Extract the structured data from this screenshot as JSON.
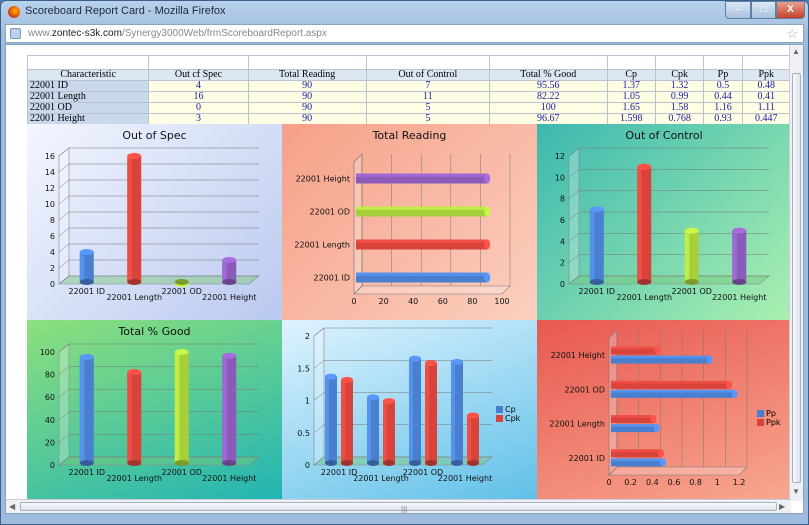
{
  "window": {
    "title": "Scoreboard Report Card - Mozilla Firefox",
    "url_prefix": "www.",
    "url_domain": "zontec-s3k.com",
    "url_path": "/Synergy3000Web/frmScoreboardReport.aspx",
    "min": "–",
    "max": "□",
    "close": "X"
  },
  "table": {
    "headers": [
      "Characteristic",
      "Out cf Spec",
      "Total Reading",
      "Out of Control",
      "Total % Good",
      "Cp",
      "Cpk",
      "Pp",
      "Ppk"
    ],
    "rows": [
      [
        "22001 ID",
        "4",
        "90",
        "7",
        "95.56",
        "1.37",
        "1.32",
        "0.5",
        "0.48"
      ],
      [
        "22001 Length",
        "16",
        "90",
        "11",
        "82.22",
        "1.05",
        "0.99",
        "0.44",
        "0.41"
      ],
      [
        "22001 OD",
        "0",
        "90",
        "5",
        "100",
        "1.65",
        "1.58",
        "1.16",
        "1.11"
      ],
      [
        "22001 Height",
        "3",
        "90",
        "5",
        "96.67",
        "1.598",
        "0.768",
        "0.93",
        "0.447"
      ]
    ]
  },
  "colors": {
    "blue": "#4a7fd0",
    "red": "#d8443c",
    "green": "#a6cf3c",
    "purple": "#8a5bb8"
  },
  "chart_data": [
    {
      "type": "bar",
      "title": "Out of Spec",
      "categories": [
        "22001 ID",
        "22001 Length",
        "22001 OD",
        "22001 Height"
      ],
      "values": [
        4,
        16,
        0,
        3
      ],
      "ylim": [
        0,
        16
      ],
      "yticks": [
        "0",
        "2",
        "4",
        "6",
        "8",
        "10",
        "12",
        "14",
        "16"
      ]
    },
    {
      "type": "bar",
      "orientation": "horizontal",
      "title": "Total Reading",
      "categories": [
        "22001 ID",
        "22001 Length",
        "22001 OD",
        "22001 Height"
      ],
      "values": [
        90,
        90,
        90,
        90
      ],
      "xlim": [
        0,
        100
      ],
      "xticks": [
        "0",
        "20",
        "40",
        "60",
        "80",
        "100"
      ]
    },
    {
      "type": "bar",
      "title": "Out of Control",
      "categories": [
        "22001 ID",
        "22001 Length",
        "22001 OD",
        "22001 Height"
      ],
      "values": [
        7,
        11,
        5,
        5
      ],
      "ylim": [
        0,
        12
      ],
      "yticks": [
        "0",
        "2",
        "4",
        "6",
        "8",
        "10",
        "12"
      ]
    },
    {
      "type": "bar",
      "title": "Total % Good",
      "categories": [
        "22001 ID",
        "22001 Length",
        "22001 OD",
        "22001 Height"
      ],
      "values": [
        95.56,
        82.22,
        100,
        96.67
      ],
      "ylim": [
        0,
        100
      ],
      "yticks": [
        "0",
        "20",
        "40",
        "60",
        "80",
        "100"
      ]
    },
    {
      "type": "bar",
      "title": "",
      "categories": [
        "22001 ID",
        "22001 Length",
        "22001 OD",
        "22001 Height"
      ],
      "series": [
        {
          "name": "Cp",
          "values": [
            1.37,
            1.05,
            1.65,
            1.598
          ]
        },
        {
          "name": "Cpk",
          "values": [
            1.32,
            0.99,
            1.58,
            0.768
          ]
        }
      ],
      "ylim": [
        0,
        2
      ],
      "yticks": [
        "0",
        "0.5",
        "1",
        "1.5",
        "2"
      ],
      "legend": "right"
    },
    {
      "type": "bar",
      "orientation": "horizontal",
      "title": "",
      "categories": [
        "22001 ID",
        "22001 Length",
        "22001 OD",
        "22001 Height"
      ],
      "series": [
        {
          "name": "Pp",
          "values": [
            0.5,
            0.44,
            1.16,
            0.93
          ]
        },
        {
          "name": "Ppk",
          "values": [
            0.48,
            0.41,
            1.11,
            0.447
          ]
        }
      ],
      "xlim": [
        0,
        1.2
      ],
      "xticks": [
        "0",
        "0.2",
        "0.4",
        "0.6",
        "0.8",
        "1",
        "1.2"
      ],
      "legend": "right"
    }
  ]
}
